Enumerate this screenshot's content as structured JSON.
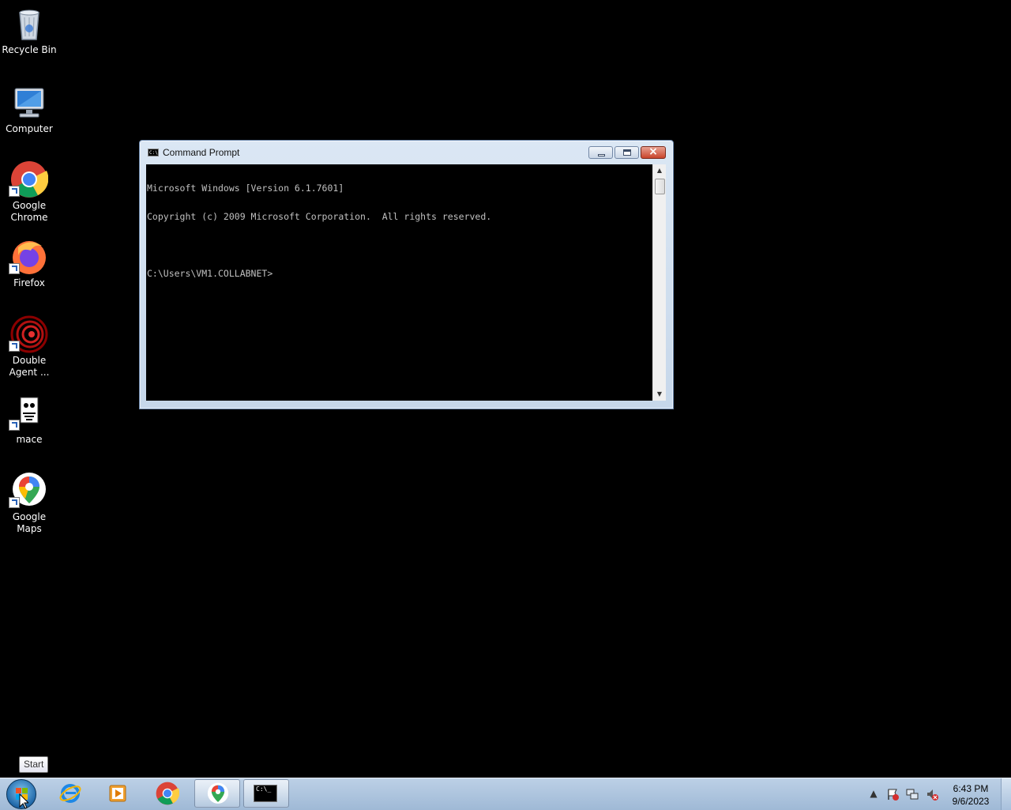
{
  "desktop": {
    "icons": [
      {
        "label": "Recycle Bin",
        "icon": "recycle-bin-icon"
      },
      {
        "label": "Computer",
        "icon": "computer-icon"
      },
      {
        "label": "Google Chrome",
        "icon": "chrome-icon"
      },
      {
        "label": "Firefox",
        "icon": "firefox-icon"
      },
      {
        "label": "Double Agent ...",
        "icon": "double-agent-icon"
      },
      {
        "label": "mace",
        "icon": "mace-icon"
      },
      {
        "label": "Google Maps",
        "icon": "google-maps-icon"
      }
    ]
  },
  "cmd_window": {
    "title": "Command Prompt",
    "icon_text": "C:\\",
    "lines": [
      "Microsoft Windows [Version 6.1.7601]",
      "Copyright (c) 2009 Microsoft Corporation.  All rights reserved.",
      "",
      "C:\\Users\\VM1.COLLABNET>"
    ]
  },
  "tooltip": {
    "text": "Start"
  },
  "taskbar": {
    "pinned": [
      {
        "name": "internet-explorer",
        "icon": "internet-explorer-icon"
      },
      {
        "name": "media-player",
        "icon": "media-player-icon"
      },
      {
        "name": "chrome",
        "icon": "chrome-icon"
      },
      {
        "name": "google-maps",
        "icon": "google-maps-icon"
      },
      {
        "name": "command-prompt",
        "icon": "command-prompt-icon",
        "icon_text": "C:\\_"
      }
    ],
    "clock": {
      "time": "6:43 PM",
      "date": "9/6/2023"
    }
  }
}
